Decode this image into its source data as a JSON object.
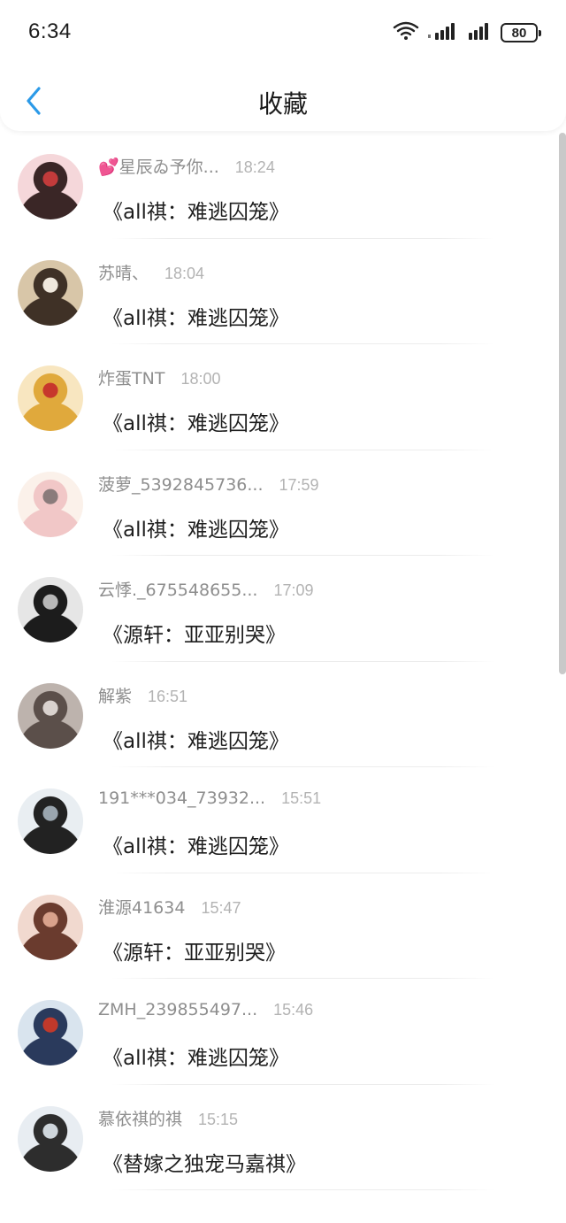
{
  "status_bar": {
    "time": "6:34",
    "battery": "80",
    "icons": [
      "wifi-icon",
      "signal-1-icon",
      "signal-2-icon",
      "battery-icon"
    ]
  },
  "nav": {
    "title": "收藏",
    "back_icon": "chevron-left-icon",
    "accent_color": "#2b9ae8"
  },
  "items": [
    {
      "name": "💕星辰ゐ予你...",
      "time": "18:24",
      "title": "《all祺：难逃囚笼》",
      "avatar_colors": [
        "#f5d7da",
        "#3a2626",
        "#c23b3b"
      ]
    },
    {
      "name": "苏晴、",
      "time": "18:04",
      "title": "《all祺：难逃囚笼》",
      "avatar_colors": [
        "#d8c6a8",
        "#3f3126",
        "#efe8dc"
      ]
    },
    {
      "name": "炸蛋TNT",
      "time": "18:00",
      "title": "《all祺：难逃囚笼》",
      "avatar_colors": [
        "#f8e6c0",
        "#e0a93c",
        "#c7372c"
      ]
    },
    {
      "name": "菠萝_5392845736...",
      "time": "17:59",
      "title": "《all祺：难逃囚笼》",
      "avatar_colors": [
        "#fbf1ea",
        "#f1c7c7",
        "#8a7b7b"
      ]
    },
    {
      "name": "云悸._675548655...",
      "time": "17:09",
      "title": "《源轩：亚亚别哭》",
      "avatar_colors": [
        "#e6e6e6",
        "#1c1c1c",
        "#b8b8b8"
      ]
    },
    {
      "name": "解紫",
      "time": "16:51",
      "title": "《all祺：难逃囚笼》",
      "avatar_colors": [
        "#bdb3ad",
        "#5b4f4a",
        "#d9d2ce"
      ]
    },
    {
      "name": "191***034_73932...",
      "time": "15:51",
      "title": "《all祺：难逃囚笼》",
      "avatar_colors": [
        "#e9eef2",
        "#222222",
        "#9aa5ae"
      ]
    },
    {
      "name": "淮源41634",
      "time": "15:47",
      "title": "《源轩：亚亚别哭》",
      "avatar_colors": [
        "#f1d9cf",
        "#6a3b2e",
        "#d9a28c"
      ]
    },
    {
      "name": "ZMH_239855497...",
      "time": "15:46",
      "title": "《all祺：难逃囚笼》",
      "avatar_colors": [
        "#d9e4ee",
        "#2a3a5c",
        "#c0392b"
      ]
    },
    {
      "name": "慕依祺的祺",
      "time": "15:15",
      "title": "《替嫁之独宠马嘉祺》",
      "avatar_colors": [
        "#e8edf2",
        "#2d2d2d",
        "#cfd6dc"
      ]
    }
  ]
}
